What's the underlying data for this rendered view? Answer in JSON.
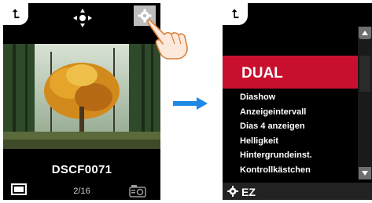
{
  "left": {
    "back_label": "⮤",
    "filename": "DSCF0071",
    "counter": "2/16"
  },
  "right": {
    "back_label": "⮤",
    "menu_header": "DUAL",
    "menu_items": [
      "Diashow",
      "Anzeigeintervall",
      "Dias 4 anzeigen",
      "Helligkeit",
      "Hintergrundeinst.",
      "Kontrollkästchen"
    ],
    "footer_label": "EZ"
  },
  "colors": {
    "header_red": "#c8102e",
    "arrow_blue": "#1e88e5"
  }
}
